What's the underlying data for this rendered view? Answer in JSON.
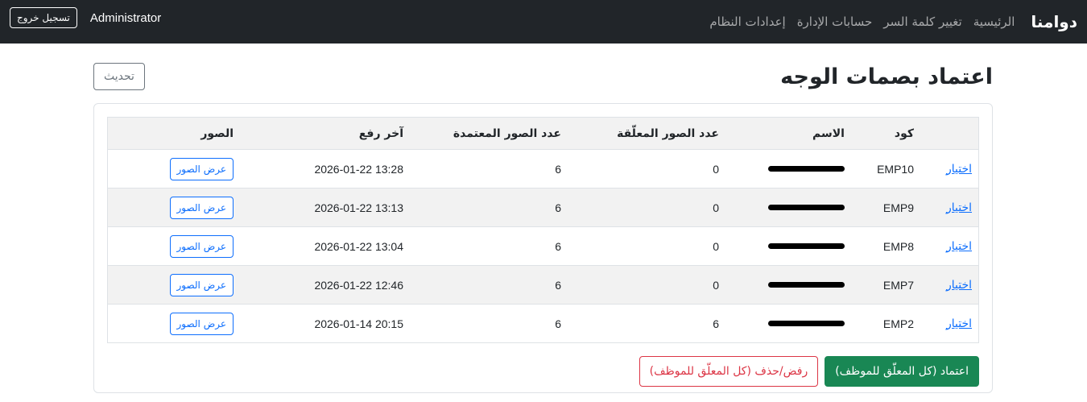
{
  "navbar": {
    "brand": "دوامنا",
    "links": [
      "الرئيسية",
      "تغيير كلمة السر",
      "حسابات الإدارة",
      "إعدادات النظام"
    ],
    "user": "Administrator",
    "logout_label": "تسجيل خروج"
  },
  "page": {
    "title": "اعتماد بصمات الوجه",
    "refresh_label": "تحديث"
  },
  "table": {
    "columns": [
      "",
      "كود",
      "الاسم",
      "عدد الصور المعلّقة",
      "عدد الصور المعتمدة",
      "آخر رفع",
      "الصور"
    ],
    "rows": [
      {
        "select": "اختيار",
        "code": "EMP10",
        "pending": "0",
        "approved": "6",
        "last_upload": "2026-01-22 13:28",
        "view": "عرض الصور"
      },
      {
        "select": "اختيار",
        "code": "EMP9",
        "pending": "0",
        "approved": "6",
        "last_upload": "2026-01-22 13:13",
        "view": "عرض الصور"
      },
      {
        "select": "اختيار",
        "code": "EMP8",
        "pending": "0",
        "approved": "6",
        "last_upload": "2026-01-22 13:04",
        "view": "عرض الصور"
      },
      {
        "select": "اختيار",
        "code": "EMP7",
        "pending": "0",
        "approved": "6",
        "last_upload": "2026-01-22 12:46",
        "view": "عرض الصور"
      },
      {
        "select": "اختيار",
        "code": "EMP2",
        "pending": "6",
        "approved": "6",
        "last_upload": "2026-01-14 20:15",
        "view": "عرض الصور"
      }
    ]
  },
  "actions": {
    "approve_label": "اعتماد (كل المعلّق للموظف)",
    "reject_label": "رفض/حذف (كل المعلّق للموظف)"
  },
  "colors": {
    "navbar_bg": "#212529",
    "primary": "#0d6efd",
    "success": "#198754",
    "danger": "#dc3545"
  }
}
